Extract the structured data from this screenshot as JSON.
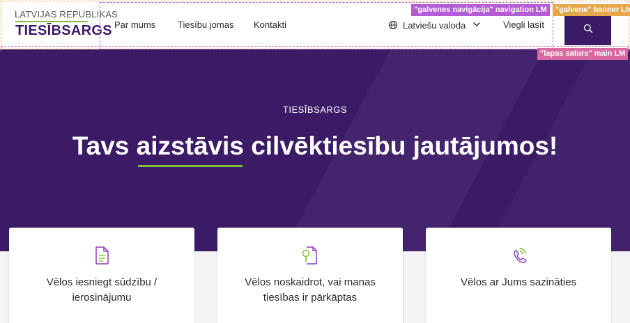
{
  "header": {
    "logo": {
      "top": "LATVIJAS REPUBLIKAS",
      "main": "TIESĪBSARGS"
    },
    "nav": [
      {
        "label": "Par mums"
      },
      {
        "label": "Tiesību jomas"
      },
      {
        "label": "Kontakti"
      }
    ],
    "language": {
      "label": "Latviešu valoda",
      "icon": "globe-icon"
    },
    "easy_read": "Viegli lasīt",
    "search_icon": "search-icon"
  },
  "landmarks": {
    "navigation": "\"galvenes navigācija\" navigation LM",
    "banner": "\"galvene\" banner LM",
    "main": "\"lapas saturs\" main LM"
  },
  "hero": {
    "eyebrow": "TIESĪBSARGS",
    "title_before": "Tavs ",
    "title_highlight": "aizstāvis",
    "title_after": " cilvēktiesību jautājumos!"
  },
  "cards": [
    {
      "icon": "document-icon",
      "text": "Vēlos iesniegt sūdzību / ierosinājumu"
    },
    {
      "icon": "document-search-icon",
      "text": "Vēlos noskaidrot, vai manas tiesības ir pārkāptas"
    },
    {
      "icon": "phone-ringing-icon",
      "text": "Vēlos ar Jums sazināties"
    }
  ],
  "colors": {
    "brand_purple": "#3c1b66",
    "accent_green": "#7fbf3a",
    "icon_purple": "#8a3fb8",
    "banner_tag": "#e8a64a",
    "nav_tag": "#b45bd6",
    "main_tag": "#d86aa1"
  }
}
